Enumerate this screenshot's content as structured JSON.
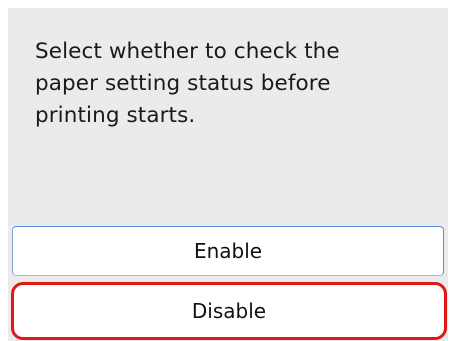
{
  "dialog": {
    "message": "Select whether to check the\npaper setting status before\nprinting starts."
  },
  "options": {
    "enable_label": "Enable",
    "disable_label": "Disable"
  },
  "colors": {
    "highlight": "#e01818",
    "screen_background": "#ebebeb"
  }
}
